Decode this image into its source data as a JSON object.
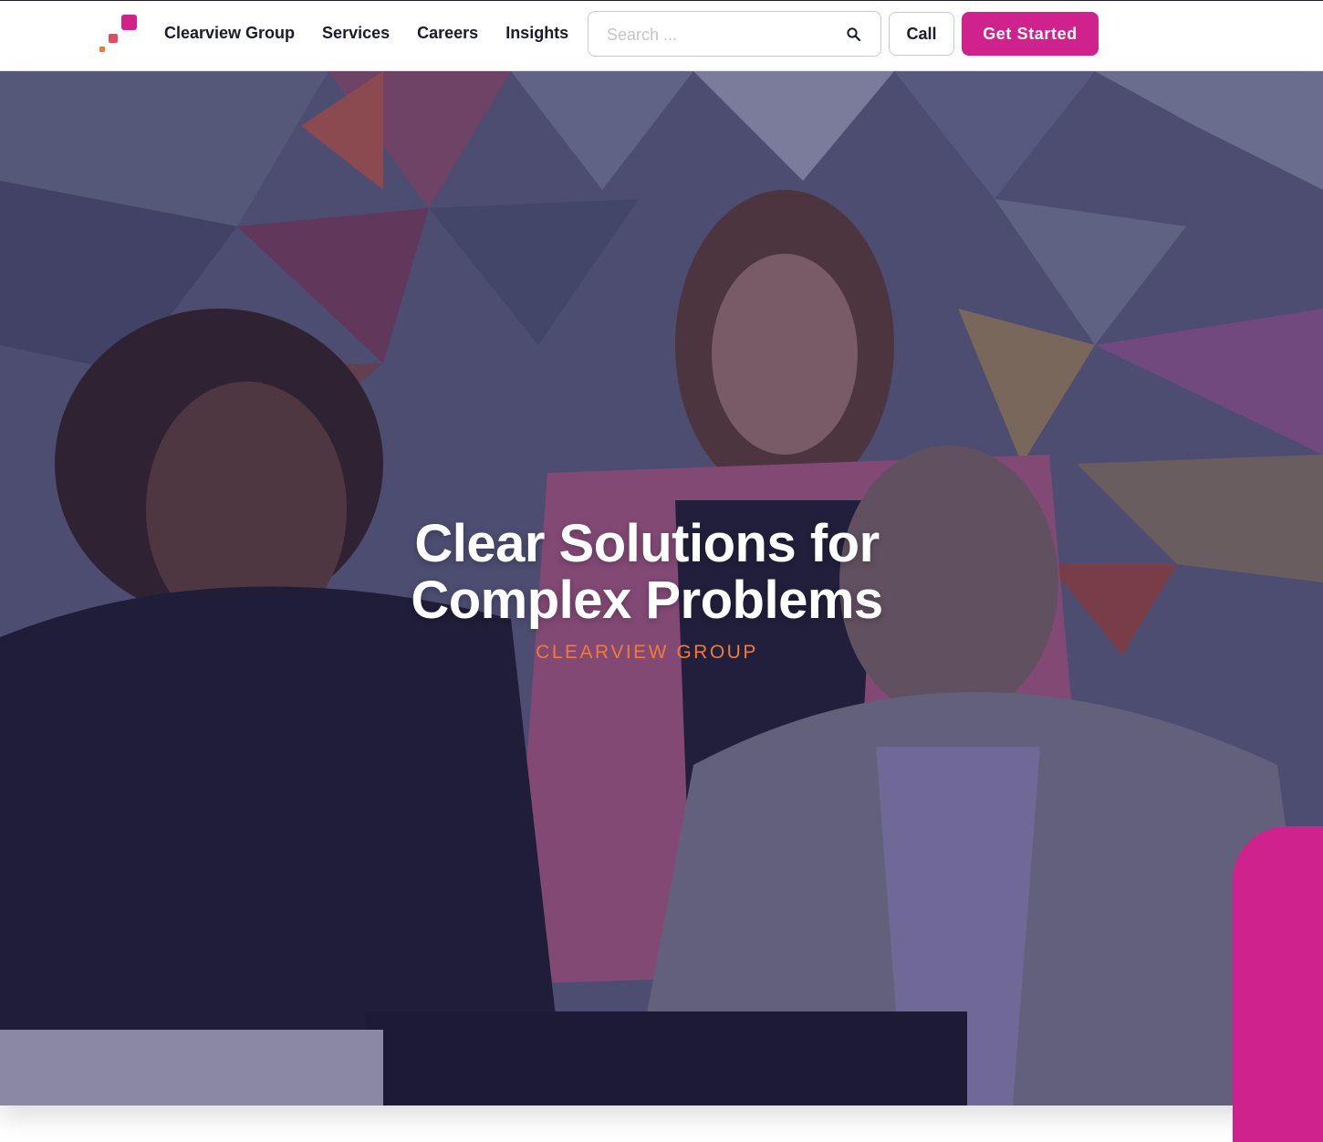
{
  "header": {
    "logo": "clearview-logo",
    "nav": [
      {
        "label": "Clearview Group"
      },
      {
        "label": "Services"
      },
      {
        "label": "Careers"
      },
      {
        "label": "Insights"
      }
    ],
    "search": {
      "placeholder": "Search ...",
      "icon": "search-icon"
    },
    "call_label": "Call",
    "cta_label": "Get Started"
  },
  "hero": {
    "title_line1": "Clear Solutions for",
    "title_line2": "Complex Problems",
    "subtitle": "CLEARVIEW GROUP"
  },
  "colors": {
    "brand_magenta": "#cf228c",
    "accent_orange": "#f07a3a",
    "nav_text": "#1b1b2e"
  }
}
